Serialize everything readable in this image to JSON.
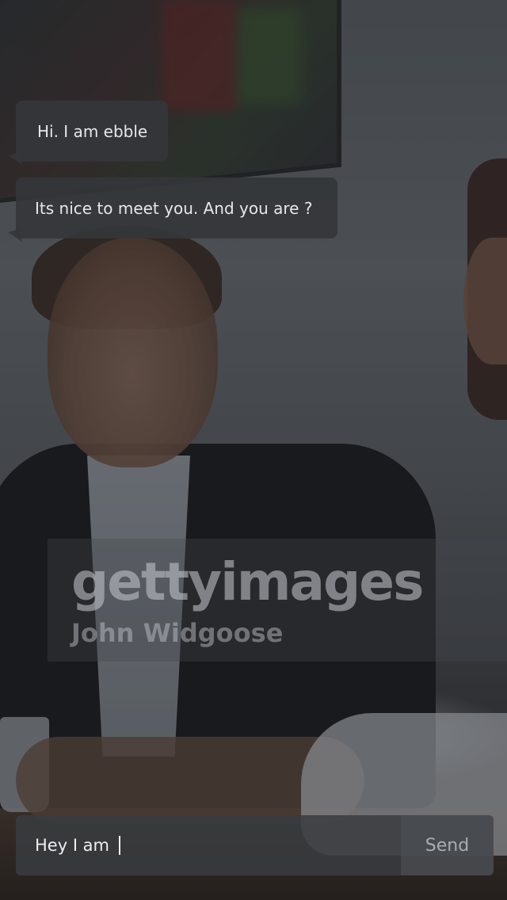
{
  "watermark": {
    "brand": "gettyimages",
    "credit": "John Widgoose"
  },
  "chat": {
    "messages": [
      {
        "text": "Hi. I am ebble"
      },
      {
        "text": "Its nice to meet you. And you are ?"
      }
    ]
  },
  "composer": {
    "value": "Hey I am",
    "send_label": "Send"
  },
  "colors": {
    "bubble_bg": "#343639",
    "text": "#e6e7e9",
    "send_text": "#a9adb2"
  }
}
